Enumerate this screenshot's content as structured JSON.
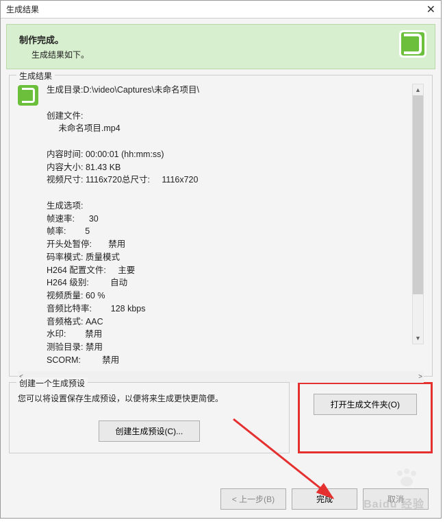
{
  "window": {
    "title": "生成结果"
  },
  "banner": {
    "title": "制作完成。",
    "subtitle": "生成结果如下。"
  },
  "results": {
    "legend": "生成结果",
    "output_dir_label": "生成目录:",
    "output_dir_value": "D:\\video\\Captures\\未命名项目\\",
    "created_files_label": "创建文件:",
    "created_file_1": "未命名项目.mp4",
    "content_duration_label": "内容时间:",
    "content_duration_value": "00:00:01 (hh:mm:ss)",
    "content_size_label": "内容大小:",
    "content_size_value": "81.43 KB",
    "video_dim_label": "视频尺寸:",
    "video_dim_value": "1116x720",
    "total_dim_label": "总尺寸:",
    "total_dim_value": "1116x720",
    "options_label": "生成选项:",
    "framerate_label": "帧速率:",
    "framerate_value": "30",
    "keyframe_label": "帧率:",
    "keyframe_value": "5",
    "pause_label": "开头处暂停:",
    "pause_value": "禁用",
    "bitrate_mode_label": "码率模式:",
    "bitrate_mode_value": "质量模式",
    "h264_profile_label": "H264 配置文件:",
    "h264_profile_value": "主要",
    "h264_level_label": "H264 级别:",
    "h264_level_value": "自动",
    "video_quality_label": "视频质量:",
    "video_quality_value": "60 %",
    "audio_bitrate_label": "音频比特率:",
    "audio_bitrate_value": "128 kbps",
    "audio_format_label": "音频格式:",
    "audio_format_value": "AAC",
    "watermark_label": "水印:",
    "watermark_value": "禁用",
    "test_dir_label": "测验目录:",
    "test_dir_value": "禁用",
    "scorm_label": "SCORM:",
    "scorm_value": "禁用"
  },
  "preset": {
    "legend": "创建一个生成预设",
    "desc": "您可以将设置保存生成预设，以便将来生成更快更简便。",
    "create_btn": "创建生成预设(C)..."
  },
  "open_folder_btn": "打开生成文件夹(O)",
  "footer": {
    "back": "< 上一步(B)",
    "finish": "完成",
    "cancel": "取消"
  },
  "watermark_text": "Baidu 经验"
}
